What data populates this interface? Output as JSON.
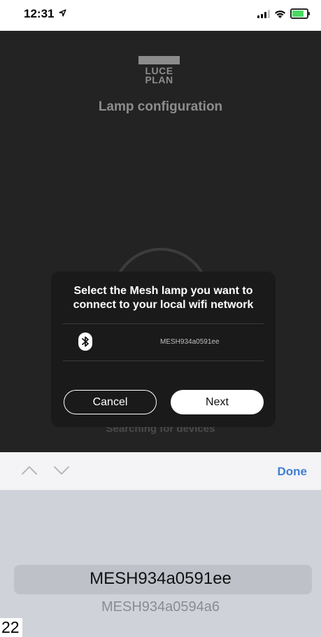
{
  "status_bar": {
    "time": "12:31",
    "location_icon": "location-arrow-icon",
    "battery_color": "#4cd964"
  },
  "app": {
    "logo_text_line1": "LUCE",
    "logo_text_line2": "PLAN",
    "title": "Lamp configuration",
    "searching_text": "Searching for devices"
  },
  "dialog": {
    "title_line1": "Select the Mesh lamp you want to",
    "title_line2": "connect to your local wifi network",
    "devices": [
      {
        "icon": "bluetooth-icon",
        "name": "MESH934a0591ee"
      }
    ],
    "cancel_label": "Cancel",
    "next_label": "Next"
  },
  "accessory_bar": {
    "done_label": "Done",
    "accent_color": "#3f7fd6"
  },
  "picker": {
    "selected": "MESH934a0591ee",
    "next_option": "MESH934a0594a6"
  },
  "page_number": "22"
}
